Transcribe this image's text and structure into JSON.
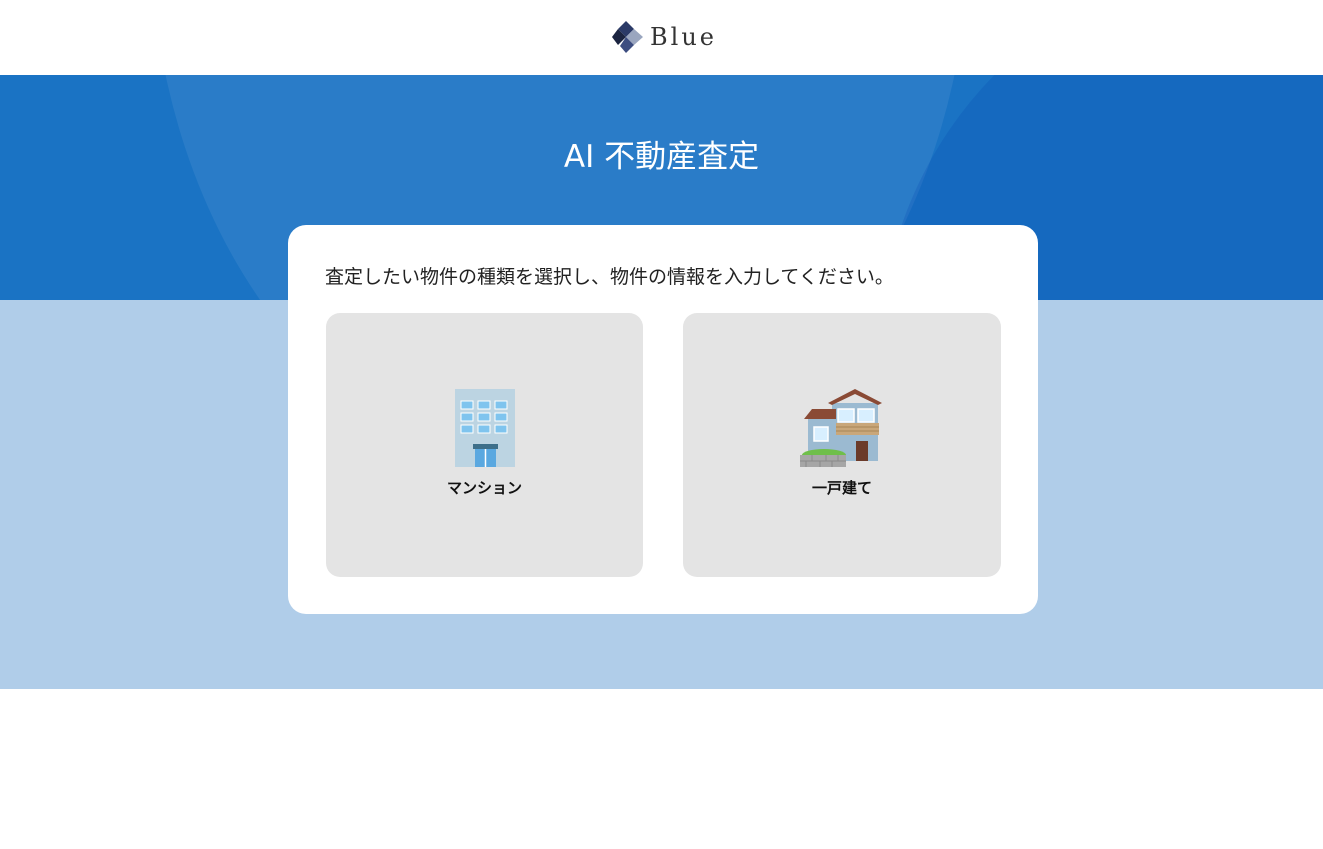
{
  "header": {
    "logo_text": "Blue",
    "logo_icon": "diamond-logo-icon"
  },
  "hero": {
    "title": "AI 不動産査定"
  },
  "card": {
    "instruction": "査定したい物件の種類を選択し、物件の情報を入力してください。",
    "options": [
      {
        "label": "マンション",
        "icon": "apartment-building-icon"
      },
      {
        "label": "一戸建て",
        "icon": "detached-house-icon"
      }
    ]
  },
  "colors": {
    "hero_bg": "#1a73c4",
    "band_bg": "#b0cde9",
    "option_bg": "#e4e4e4",
    "logo_dark": "#2b3a67"
  }
}
